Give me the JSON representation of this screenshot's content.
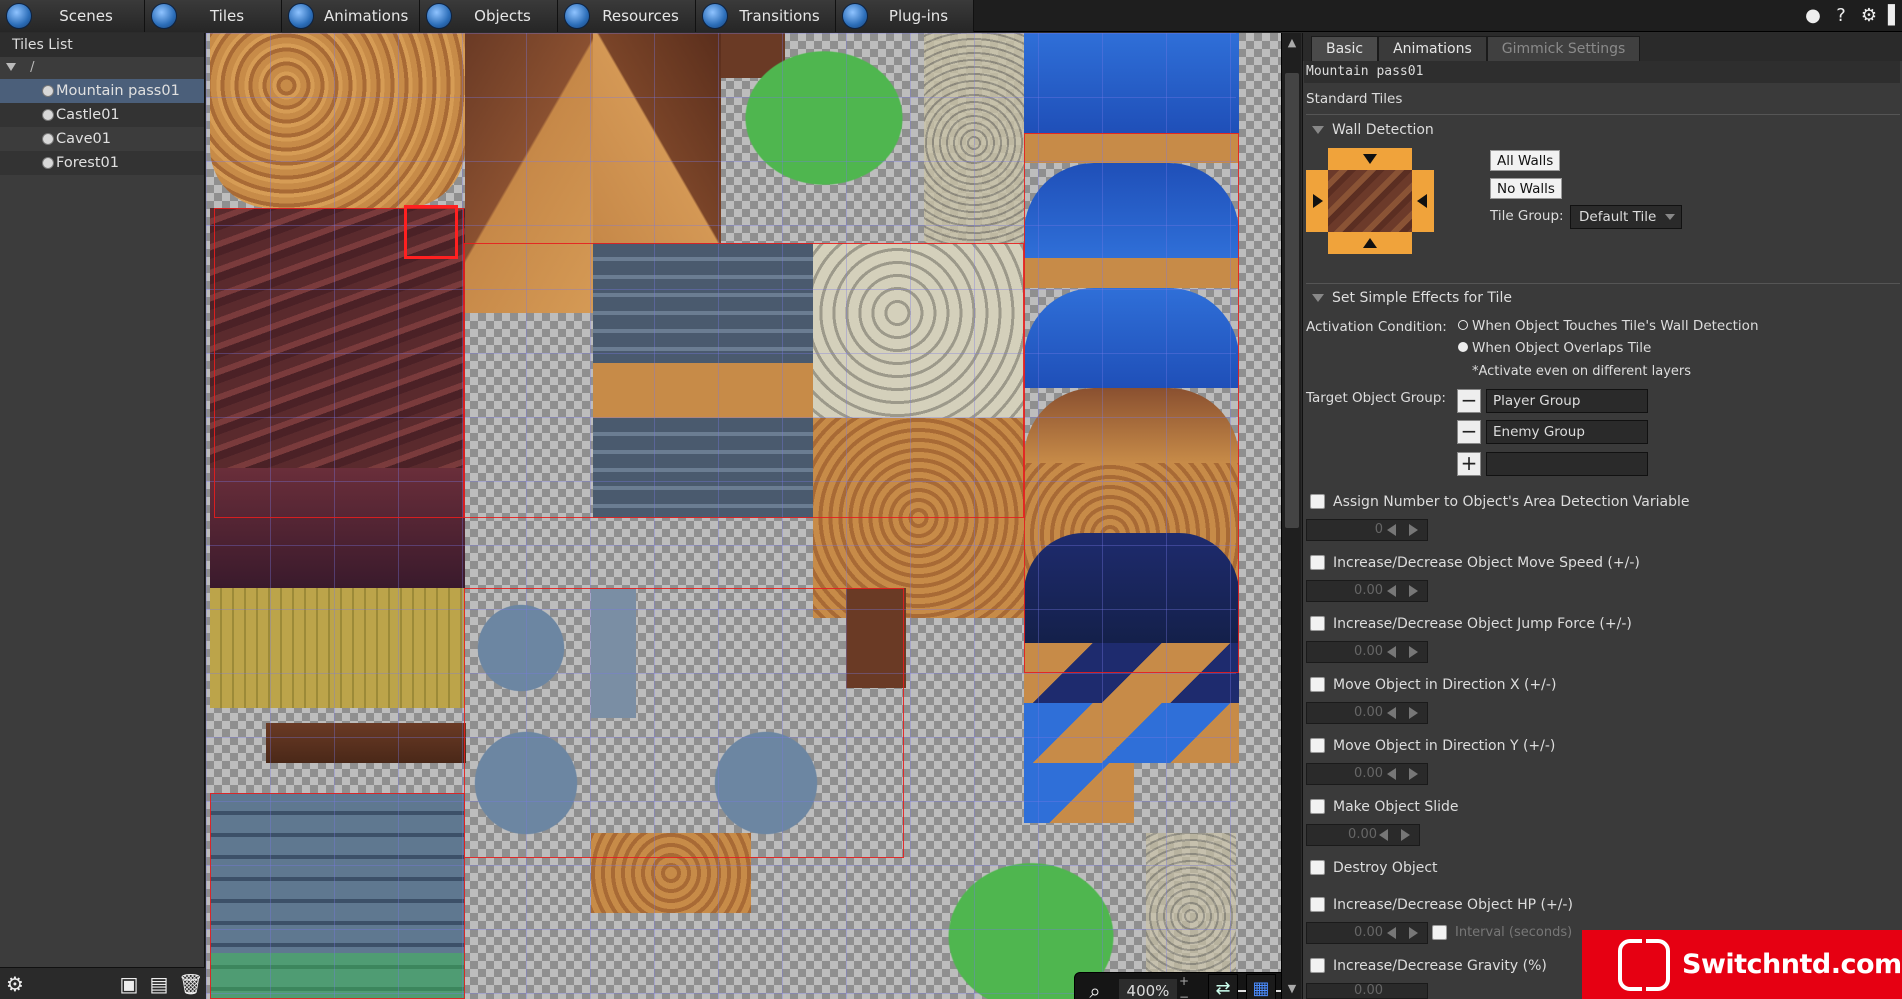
{
  "menubar": {
    "tabs": [
      {
        "label": "Scenes",
        "icon": "scenes-icon"
      },
      {
        "label": "Tiles",
        "icon": "tiles-icon"
      },
      {
        "label": "Animations",
        "icon": "animations-icon"
      },
      {
        "label": "Objects",
        "icon": "objects-icon"
      },
      {
        "label": "Resources",
        "icon": "resources-icon"
      },
      {
        "label": "Transitions",
        "icon": "transitions-icon"
      },
      {
        "label": "Plug-ins",
        "icon": "plugins-icon"
      }
    ],
    "right_icons": [
      "globe-icon",
      "help-icon",
      "gear-icon"
    ]
  },
  "tiles_list": {
    "header": "Tiles List",
    "root": "/",
    "items": [
      "Mountain pass01",
      "Castle01",
      "Cave01",
      "Forest01"
    ],
    "selected": "Mountain pass01"
  },
  "canvas": {
    "zoom": "400%",
    "zoom_plus": "+",
    "zoom_minus": "−"
  },
  "properties": {
    "tabs": [
      "Basic",
      "Animations",
      "Gimmick Settings"
    ],
    "active_tab": "Basic",
    "tile_name": "Mountain pass01",
    "tile_type": "Standard Tiles",
    "wall_detection": {
      "title": "Wall Detection",
      "all_walls": "All Walls",
      "no_walls": "No Walls",
      "tile_group_label": "Tile Group:",
      "tile_group_value": "Default Tile"
    },
    "effects": {
      "title": "Set Simple Effects for Tile",
      "activation_label": "Activation Condition:",
      "activation_opt1": "When Object Touches Tile's Wall Detection",
      "activation_opt2": "When Object Overlaps Tile",
      "activation_note": "*Activate even on different layers",
      "target_label": "Target Object Group:",
      "groups": [
        "Player Group",
        "Enemy Group",
        ""
      ],
      "options": [
        {
          "label": "Assign Number to Object's Area Detection Variable",
          "value": "0"
        },
        {
          "label": "Increase/Decrease Object Move Speed (+/-)",
          "value": "0.00"
        },
        {
          "label": "Increase/Decrease Object Jump Force (+/-)",
          "value": "0.00"
        },
        {
          "label": "Move Object in Direction X (+/-)",
          "value": "0.00"
        },
        {
          "label": "Move Object in Direction Y (+/-)",
          "value": "0.00"
        },
        {
          "label": "Make Object Slide",
          "value": "0.00"
        },
        {
          "label": "Destroy Object",
          "value": ""
        },
        {
          "label": "Increase/Decrease Object HP (+/-)",
          "value": "0.00"
        },
        {
          "label": "Increase/Decrease Gravity (%)",
          "value": "0.00"
        }
      ],
      "interval_label": "Interval (seconds)"
    }
  },
  "watermark": {
    "text": "Switchntd.com"
  },
  "colors": {
    "accent_orange": "#f0a33b",
    "selection_blue": "#4b5f7a",
    "grid_red": "#e61e1e",
    "watermark_red": "#e60012"
  }
}
